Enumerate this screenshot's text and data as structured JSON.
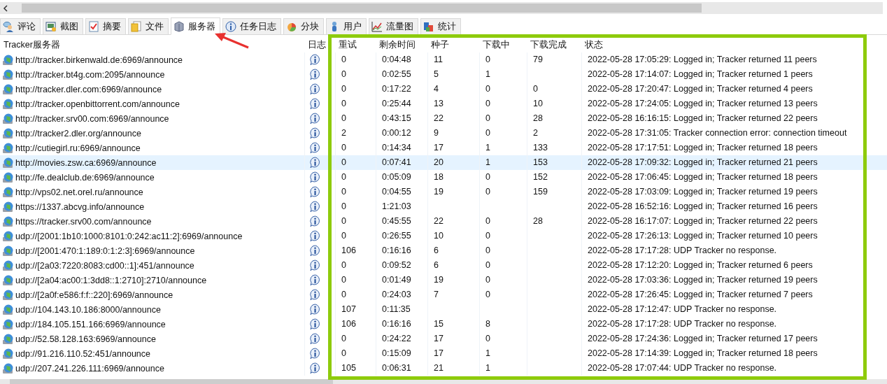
{
  "tabs": [
    {
      "label": "评论",
      "selected": false
    },
    {
      "label": "截图",
      "selected": false
    },
    {
      "label": "摘要",
      "selected": false
    },
    {
      "label": "文件",
      "selected": false
    },
    {
      "label": "服务器",
      "selected": true
    },
    {
      "label": "任务日志",
      "selected": false
    },
    {
      "label": "分块",
      "selected": false
    },
    {
      "label": "用户",
      "selected": false
    },
    {
      "label": "流量图",
      "selected": false
    },
    {
      "label": "统计",
      "selected": false
    }
  ],
  "table": {
    "columns": [
      "Tracker服务器",
      "日志",
      "重试",
      "剩余时间",
      "种子",
      "下载中",
      "下载完成",
      "状态"
    ],
    "rows": [
      {
        "selected": false,
        "cells": [
          "http://tracker.birkenwald.de:6969/announce",
          "",
          "0",
          "0:04:48",
          "11",
          "0",
          "79",
          "2022-05-28 17:05:29: Logged in; Tracker returned 11 peers"
        ]
      },
      {
        "selected": false,
        "cells": [
          "http://tracker.bt4g.com:2095/announce",
          "",
          "0",
          "0:02:55",
          "5",
          "1",
          "",
          "2022-05-28 17:14:07: Logged in; Tracker returned 1 peers"
        ]
      },
      {
        "selected": false,
        "cells": [
          "http://tracker.dler.com:6969/announce",
          "",
          "0",
          "0:17:22",
          "4",
          "0",
          "0",
          "2022-05-28 17:20:47: Logged in; Tracker returned 4 peers"
        ]
      },
      {
        "selected": false,
        "cells": [
          "http://tracker.openbittorrent.com/announce",
          "",
          "0",
          "0:25:44",
          "13",
          "0",
          "10",
          "2022-05-28 17:24:05: Logged in; Tracker returned 13 peers"
        ]
      },
      {
        "selected": false,
        "cells": [
          "http://tracker.srv00.com:6969/announce",
          "",
          "0",
          "0:43:15",
          "22",
          "0",
          "28",
          "2022-05-28 16:16:15: Logged in; Tracker returned 22 peers"
        ]
      },
      {
        "selected": false,
        "cells": [
          "http://tracker2.dler.org/announce",
          "",
          "2",
          "0:00:12",
          "9",
          "0",
          "2",
          "2022-05-28 17:31:05: Tracker connection error: connection timeout"
        ]
      },
      {
        "selected": false,
        "cells": [
          "http://cutiegirl.ru:6969/announce",
          "",
          "0",
          "0:14:34",
          "17",
          "1",
          "133",
          "2022-05-28 17:17:51: Logged in; Tracker returned 18 peers"
        ]
      },
      {
        "selected": true,
        "cells": [
          "http://movies.zsw.ca:6969/announce",
          "",
          "0",
          "0:07:41",
          "20",
          "1",
          "153",
          "2022-05-28 17:09:32: Logged in; Tracker returned 21 peers"
        ]
      },
      {
        "selected": false,
        "cells": [
          "http://fe.dealclub.de:6969/announce",
          "",
          "0",
          "0:05:09",
          "18",
          "0",
          "152",
          "2022-05-28 17:06:45: Logged in; Tracker returned 18 peers"
        ]
      },
      {
        "selected": false,
        "cells": [
          "http://vps02.net.orel.ru/announce",
          "",
          "0",
          "0:04:55",
          "19",
          "0",
          "159",
          "2022-05-28 17:03:09: Logged in; Tracker returned 19 peers"
        ]
      },
      {
        "selected": false,
        "cells": [
          "https://1337.abcvg.info/announce",
          "",
          "0",
          "1:21:03",
          "",
          "",
          "",
          "2022-05-28 16:52:16: Logged in; Tracker returned 16 peers"
        ]
      },
      {
        "selected": false,
        "cells": [
          "https://tracker.srv00.com/announce",
          "",
          "0",
          "0:45:55",
          "22",
          "0",
          "28",
          "2022-05-28 16:17:07: Logged in; Tracker returned 22 peers"
        ]
      },
      {
        "selected": false,
        "cells": [
          "udp://[2001:1b10:1000:8101:0:242:ac11:2]:6969/announce",
          "",
          "0",
          "0:26:55",
          "10",
          "0",
          "",
          "2022-05-28 17:26:13: Logged in; Tracker returned 10 peers"
        ]
      },
      {
        "selected": false,
        "cells": [
          "udp://[2001:470:1:189:0:1:2:3]:6969/announce",
          "",
          "106",
          "0:16:16",
          "6",
          "0",
          "",
          "2022-05-28 17:17:28: UDP Tracker no response."
        ]
      },
      {
        "selected": false,
        "cells": [
          "udp://[2a03:7220:8083:cd00::1]:451/announce",
          "",
          "0",
          "0:09:52",
          "6",
          "0",
          "",
          "2022-05-28 17:12:20: Logged in; Tracker returned 6 peers"
        ]
      },
      {
        "selected": false,
        "cells": [
          "udp://[2a04:ac00:1:3dd8::1:2710]:2710/announce",
          "",
          "0",
          "0:01:49",
          "19",
          "0",
          "",
          "2022-05-28 17:03:36: Logged in; Tracker returned 19 peers"
        ]
      },
      {
        "selected": false,
        "cells": [
          "udp://[2a0f:e586:f:f::220]:6969/announce",
          "",
          "0",
          "0:24:03",
          "7",
          "0",
          "",
          "2022-05-28 17:26:45: Logged in; Tracker returned 7 peers"
        ]
      },
      {
        "selected": false,
        "cells": [
          "udp://104.143.10.186:8000/announce",
          "",
          "107",
          "0:11:35",
          "",
          "",
          "",
          "2022-05-28 17:12:47: UDP Tracker no response."
        ]
      },
      {
        "selected": false,
        "cells": [
          "udp://184.105.151.166:6969/announce",
          "",
          "106",
          "0:16:16",
          "15",
          "8",
          "",
          "2022-05-28 17:17:28: UDP Tracker no response."
        ]
      },
      {
        "selected": false,
        "cells": [
          "udp://52.58.128.163:6969/announce",
          "",
          "0",
          "0:24:22",
          "17",
          "0",
          "",
          "2022-05-28 17:24:36: Logged in; Tracker returned 17 peers"
        ]
      },
      {
        "selected": false,
        "cells": [
          "udp://91.216.110.52:451/announce",
          "",
          "0",
          "0:15:09",
          "17",
          "1",
          "",
          "2022-05-28 17:14:39: Logged in; Tracker returned 18 peers"
        ]
      },
      {
        "selected": false,
        "cells": [
          "udp://207.241.226.111:6969/announce",
          "",
          "105",
          "0:06:31",
          "21",
          "1",
          "",
          "2022-05-28 17:07:44: UDP Tracker no response."
        ]
      }
    ]
  },
  "annotations": {
    "frame": true,
    "arrow": true
  }
}
